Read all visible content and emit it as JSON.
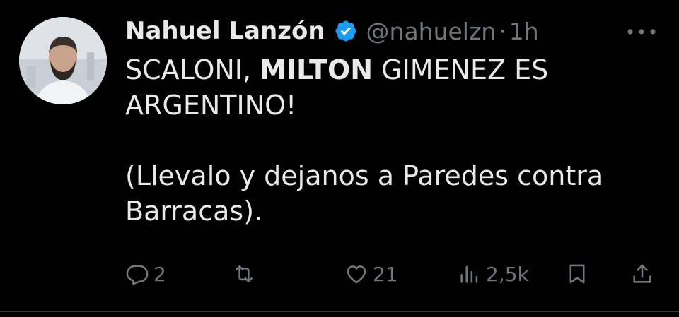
{
  "author": {
    "name": "Nahuel Lanzón",
    "handle": "@nahuelzn",
    "separator": "·",
    "time": "1h",
    "verified_color": "#1d9bf0"
  },
  "tweet": {
    "line1_pre": "SCALONI, ",
    "line1_bold": "MILTON",
    "line1_post": " GIMENEZ ES",
    "line2": "ARGENTINO!",
    "line3": "(Llevalo y dejanos a Paredes contra",
    "line4": "Barracas)."
  },
  "actions": {
    "replies": "2",
    "retweets": "",
    "likes": "21",
    "views": "2,5k"
  },
  "icons": {
    "more": "more-icon",
    "reply": "reply-icon",
    "retweet": "retweet-icon",
    "like": "heart-icon",
    "views": "views-icon",
    "bookmark": "bookmark-icon",
    "share": "share-icon"
  },
  "colors": {
    "background": "#000000",
    "text": "#e7e9ea",
    "muted": "#71767b"
  }
}
